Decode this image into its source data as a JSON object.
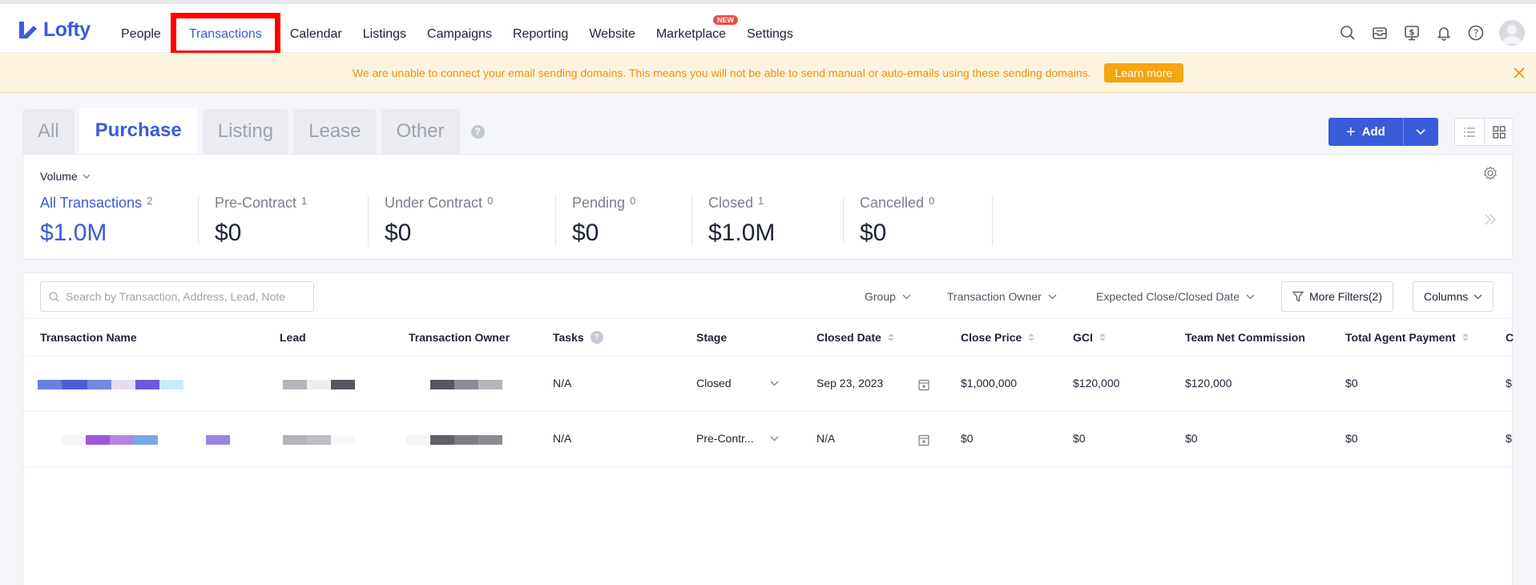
{
  "brand": {
    "name": "Lofty"
  },
  "nav": {
    "items": [
      {
        "label": "People"
      },
      {
        "label": "Transactions"
      },
      {
        "label": "Calendar"
      },
      {
        "label": "Listings"
      },
      {
        "label": "Campaigns"
      },
      {
        "label": "Reporting"
      },
      {
        "label": "Website"
      },
      {
        "label": "Marketplace",
        "badge": "NEW"
      },
      {
        "label": "Settings"
      }
    ],
    "active": "Transactions",
    "right_icons": [
      "search-icon",
      "inbox-icon",
      "dollar-monitor-icon",
      "bell-icon",
      "help-icon",
      "avatar"
    ]
  },
  "banner": {
    "message": "We are unable to connect your email sending domains. This means you will not be able to send manual or auto-emails using these sending domains.",
    "button": "Learn more"
  },
  "tabs": {
    "items": [
      {
        "label": "All"
      },
      {
        "label": "Purchase"
      },
      {
        "label": "Listing"
      },
      {
        "label": "Lease"
      },
      {
        "label": "Other"
      }
    ],
    "active": "Purchase",
    "help": "?"
  },
  "toolbar": {
    "add_label": "Add"
  },
  "stats": {
    "metric": "Volume",
    "items": [
      {
        "label": "All Transactions",
        "count": "2",
        "value": "$1.0M"
      },
      {
        "label": "Pre-Contract",
        "count": "1",
        "value": "$0"
      },
      {
        "label": "Under Contract",
        "count": "0",
        "value": "$0"
      },
      {
        "label": "Pending",
        "count": "0",
        "value": "$0"
      },
      {
        "label": "Closed",
        "count": "1",
        "value": "$1.0M"
      },
      {
        "label": "Cancelled",
        "count": "0",
        "value": "$0"
      }
    ]
  },
  "filters": {
    "search_placeholder": "Search by Transaction, Address, Lead, Note",
    "group": "Group",
    "owner": "Transaction Owner",
    "date": "Expected Close/Closed Date",
    "more": "More Filters(2)",
    "columns": "Columns"
  },
  "table": {
    "columns": [
      {
        "label": "Transaction Name"
      },
      {
        "label": "Lead"
      },
      {
        "label": "Transaction Owner"
      },
      {
        "label": "Tasks"
      },
      {
        "label": "Stage"
      },
      {
        "label": "Closed Date"
      },
      {
        "label": "Close Price"
      },
      {
        "label": "GCI"
      },
      {
        "label": "Team Net Commission"
      },
      {
        "label": "Total Agent Payment"
      },
      {
        "label": "C"
      }
    ],
    "rows": [
      {
        "tasks": "N/A",
        "stage": "Closed",
        "closed_date": "Sep 23, 2023",
        "close_price": "$1,000,000",
        "gci": "$120,000",
        "team_net": "$120,000",
        "agent_payment": "$0",
        "extra": "$"
      },
      {
        "tasks": "N/A",
        "stage": "Pre-Contr...",
        "closed_date": "N/A",
        "close_price": "$0",
        "gci": "$0",
        "team_net": "$0",
        "agent_payment": "$0",
        "extra": "$"
      }
    ]
  },
  "colors": {
    "accent": "#3a5bd9",
    "banner_bg": "#fdf4e0",
    "banner_text": "#e6930f",
    "learn_more": "#f5a512",
    "badge": "#f04848",
    "highlight_box": "#ff0000"
  }
}
